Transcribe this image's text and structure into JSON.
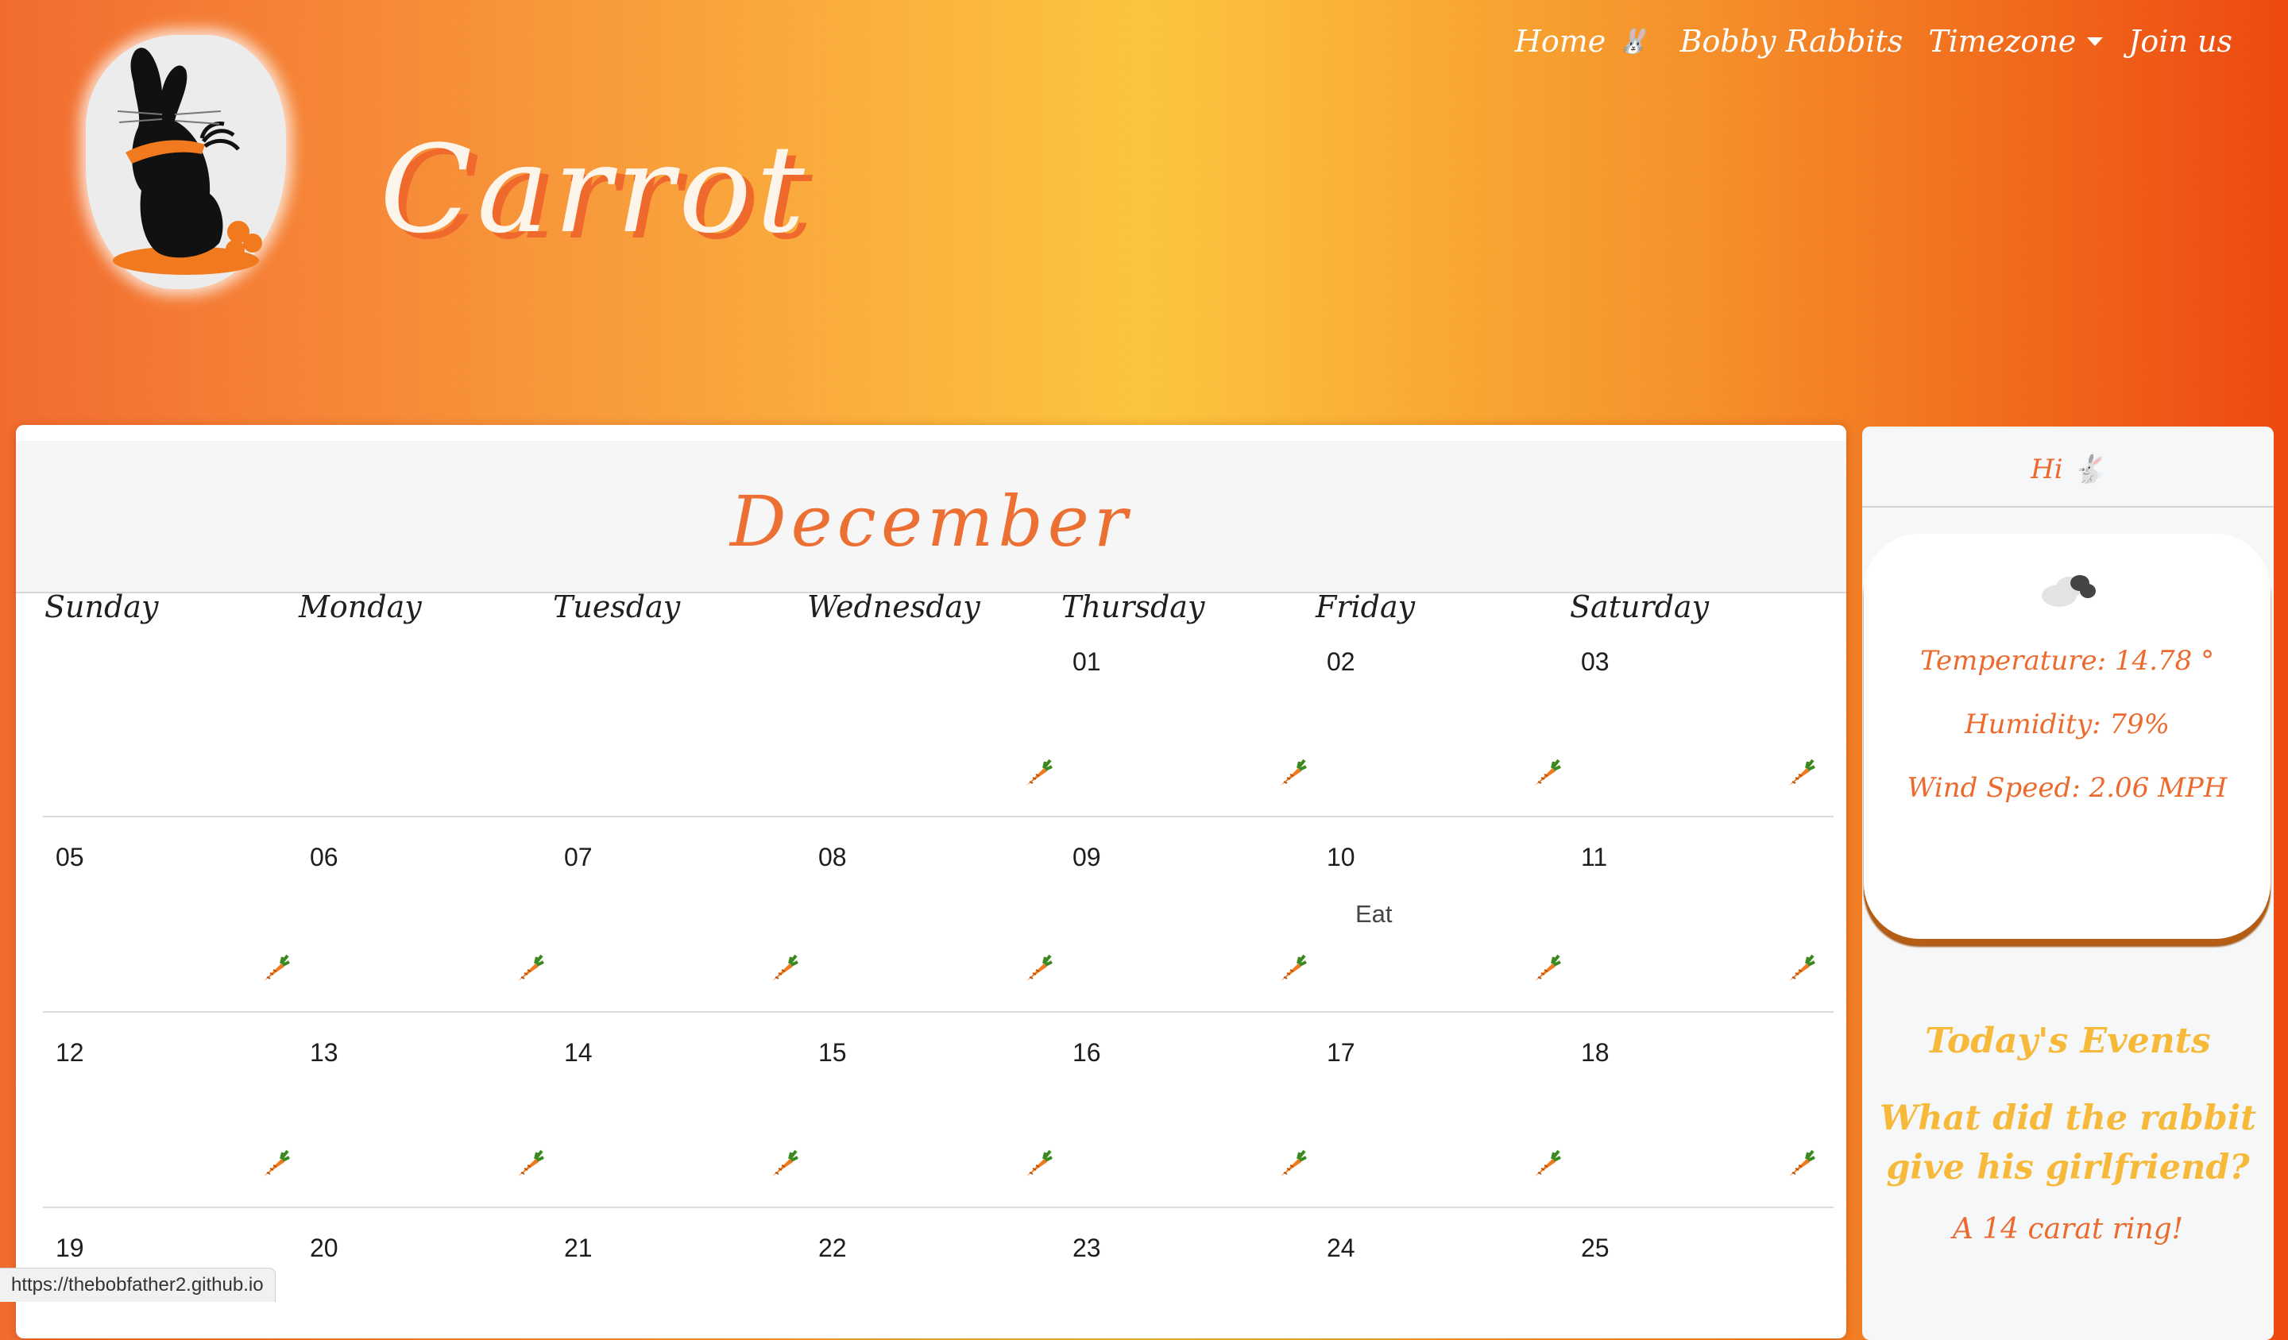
{
  "brand": {
    "name": "Carrot"
  },
  "nav": {
    "home": "Home",
    "home_emoji": "🐰",
    "bobby": "Bobby Rabbits",
    "timezone": "Timezone",
    "join": "Join us"
  },
  "calendar": {
    "month": "December",
    "weekdays": [
      "Sunday",
      "Monday",
      "Tuesday",
      "Wednesday",
      "Thursday",
      "Friday",
      "Saturday"
    ],
    "weeks": [
      [
        "",
        "",
        "",
        "",
        "01",
        "02",
        "03"
      ],
      [
        "05",
        "06",
        "07",
        "08",
        "09",
        "10",
        "11"
      ],
      [
        "12",
        "13",
        "14",
        "15",
        "16",
        "17",
        "18"
      ],
      [
        "19",
        "20",
        "21",
        "22",
        "23",
        "24",
        "25"
      ]
    ],
    "events": [
      {
        "day": "10",
        "text": "Eat"
      }
    ]
  },
  "sidebar": {
    "greeting": "Hi 🐇",
    "weather": {
      "temperature": "Temperature: 14.78 °",
      "humidity": "Humidity: 79%",
      "wind": "Wind Speed: 2.06 MPH"
    },
    "events_title": "Today's Events",
    "joke": "What did the rabbit give his girlfriend?",
    "answer": "A 14 carat ring!"
  },
  "status_bar": {
    "url": "https://thebobfather2.github.io"
  },
  "colors": {
    "accent": "#ec7033",
    "gold": "#f7b93a",
    "carrot": "#f07a1d",
    "leaf": "#3a8a1f"
  }
}
